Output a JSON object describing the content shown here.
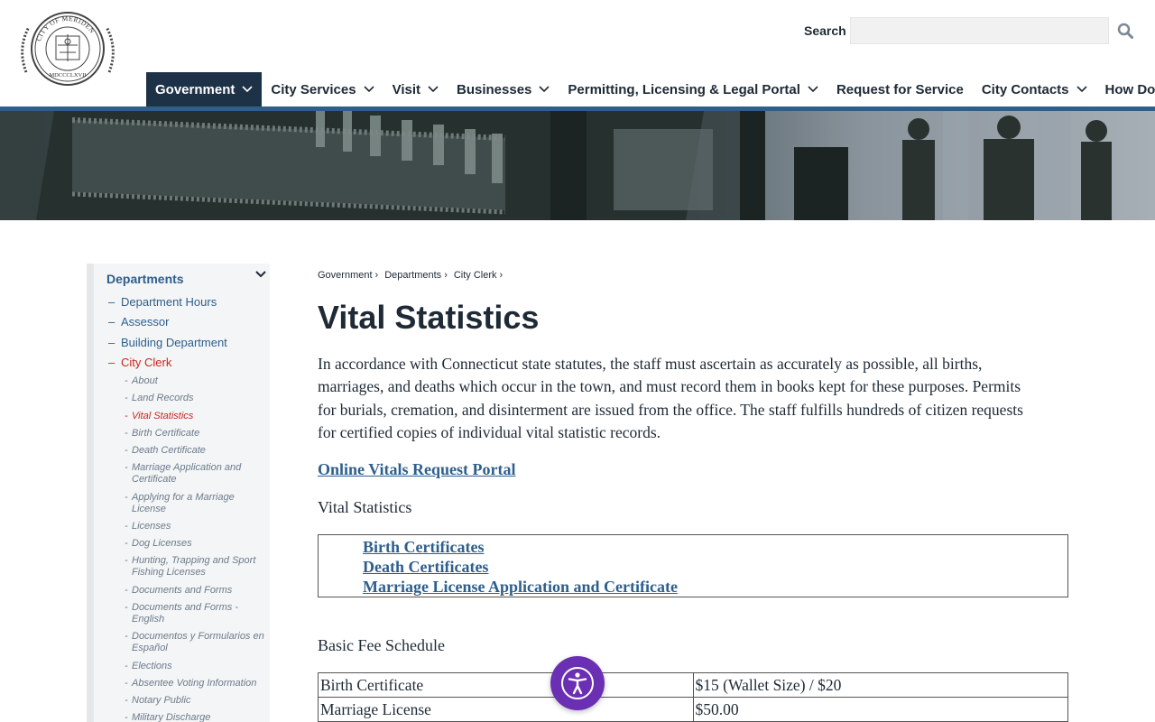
{
  "header": {
    "logo_alt": "City of Meriden seal",
    "logo_text": "CITY OF MERIDEN",
    "logo_roman": "MDCCCLXVII",
    "search": {
      "label": "Search",
      "placeholder": "",
      "value": "",
      "icon": "search-icon"
    }
  },
  "nav": {
    "items": [
      {
        "label": "Government",
        "active": true,
        "has_dropdown": true
      },
      {
        "label": "City Services",
        "has_dropdown": true
      },
      {
        "label": "Visit",
        "has_dropdown": true
      },
      {
        "label": "Businesses",
        "has_dropdown": true
      },
      {
        "label": "Permitting, Licensing & Legal Portal",
        "has_dropdown": true
      },
      {
        "label": "Request for Service",
        "has_dropdown": false
      },
      {
        "label": "City Contacts",
        "has_dropdown": true
      },
      {
        "label": "How Do I?",
        "has_dropdown": true
      }
    ]
  },
  "sidebar": {
    "heading": "Departments",
    "toggle_icon": "chevron-down-icon",
    "level1": [
      {
        "label": "Department Hours"
      },
      {
        "label": "Assessor"
      },
      {
        "label": "Building Department"
      },
      {
        "label": "City Clerk",
        "current": true
      }
    ],
    "level2": [
      {
        "label": "About"
      },
      {
        "label": "Land Records"
      },
      {
        "label": "Vital Statistics",
        "current": true
      },
      {
        "label": "Birth Certificate"
      },
      {
        "label": "Death Certificate"
      },
      {
        "label": "Marriage Application and Certificate"
      },
      {
        "label": "Applying for a Marriage License"
      },
      {
        "label": "Licenses"
      },
      {
        "label": "Dog Licenses"
      },
      {
        "label": "Hunting, Trapping and Sport Fishing Licenses"
      },
      {
        "label": "Documents and Forms"
      },
      {
        "label": "Documents and Forms - English"
      },
      {
        "label": "Documentos y Formularios en Español"
      },
      {
        "label": "Elections"
      },
      {
        "label": "Absentee Voting Information"
      },
      {
        "label": "Notary Public"
      },
      {
        "label": "Military Discharge"
      }
    ]
  },
  "breadcrumb": [
    "Government",
    "Departments",
    "City Clerk"
  ],
  "breadcrumb_sep": "›",
  "page": {
    "title": "Vital Statistics",
    "intro": "In accordance with Connecticut state statutes, the staff must ascertain as accurately as possible, all births, marriages, and deaths which occur in the town, and must record them in books kept for these purposes.  Permits for burials, cremation, and disinterment are issued from the office. The staff fulfills hundreds of citizen requests for certified copies of individual vital statistic records.",
    "portal_link": "Online Vitals Request Portal ",
    "vs_heading": "Vital Statistics",
    "vs_links": [
      "Birth Certificates",
      " Death Certificates ",
      " Marriage License Application and Certificate"
    ],
    "fee_heading": "Basic Fee Schedule",
    "fees": [
      {
        "item": "Birth Certificate",
        "fee": "$15 (Wallet Size) / $20"
      },
      {
        "item": "Marriage License",
        "fee": "$50.00"
      }
    ]
  },
  "accessibility": {
    "icon": "accessibility-icon",
    "color": "#6b2fb3"
  },
  "colors": {
    "nav_active": "#1e3247",
    "accent": "#2e5f8c",
    "current": "#c9261d"
  }
}
